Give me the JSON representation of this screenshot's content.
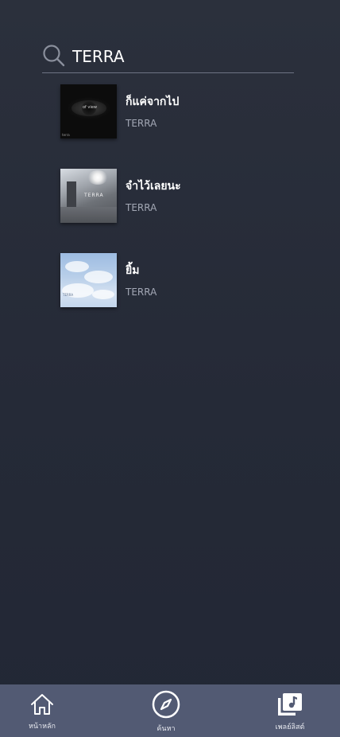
{
  "search": {
    "value": "TERRA",
    "icon": "search-icon"
  },
  "results": [
    {
      "title": "ก็แค่จากไป",
      "artist": "TERRA",
      "cover_text": "of view",
      "cover_tag": "terra"
    },
    {
      "title": "จำไว้เลยนะ",
      "artist": "TERRA",
      "cover_text": "TERRA"
    },
    {
      "title": "ยิ้ม",
      "artist": "TERRA",
      "cover_tag": "TERRA"
    }
  ],
  "nav": {
    "home_label": "หน้าหลัก",
    "explore_label": "ค้นหา",
    "playlist_label": "เพลย์ลิสต์",
    "home_icon": "home-icon",
    "explore_icon": "compass-icon",
    "playlist_icon": "playlist-icon"
  },
  "colors": {
    "background": "#272c39",
    "nav_background": "#525a73",
    "artist_text": "#a3a8b5",
    "divider": "#6d7384"
  }
}
